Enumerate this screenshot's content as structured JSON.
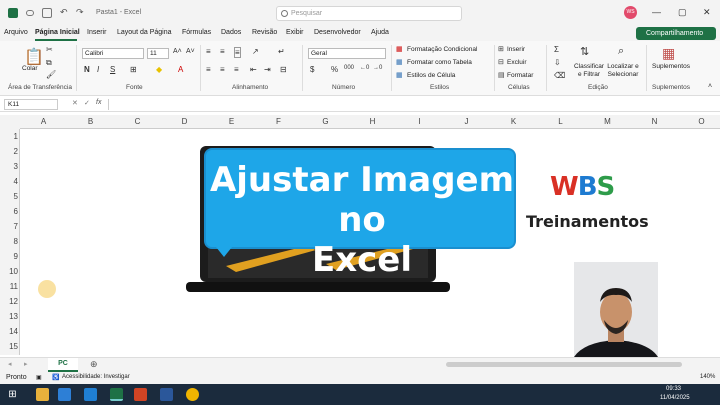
{
  "window": {
    "title": "Pasta1 - Excel",
    "search_placeholder": "Pesquisar",
    "user_initials": "WS"
  },
  "menu": {
    "items": [
      "Arquivo",
      "Página Inicial",
      "Inserir",
      "Layout da Página",
      "Fórmulas",
      "Dados",
      "Revisão",
      "Exibir",
      "Desenvolvedor",
      "Ajuda"
    ],
    "share_label": "Compartilhamento"
  },
  "ribbon": {
    "clipboard": {
      "paste_label": "Colar",
      "group_label": "Área de Transferência"
    },
    "font": {
      "font_name": "Calibri",
      "font_size": "11",
      "group_label": "Fonte"
    },
    "alignment": {
      "group_label": "Alinhamento"
    },
    "number": {
      "format": "Geral",
      "group_label": "Número"
    },
    "styles": {
      "conditional": "Formatação Condicional",
      "as_table": "Formatar como Tabela",
      "cell_styles": "Estilos de Célula",
      "group_label": "Estilos"
    },
    "cells": {
      "insert": "Inserir",
      "delete": "Excluir",
      "format": "Formatar",
      "group_label": "Células"
    },
    "editing": {
      "sort_filter": "Classificar e Filtrar",
      "find_select": "Localizar e Selecionar",
      "group_label": "Edição"
    },
    "addins": {
      "label": "Suplementos",
      "group_label": "Suplementos"
    }
  },
  "formula_bar": {
    "name_box": "K11",
    "fx": "fx"
  },
  "sheet": {
    "columns": [
      "A",
      "B",
      "C",
      "D",
      "E",
      "F",
      "G",
      "H",
      "I",
      "J",
      "K",
      "L",
      "M",
      "N",
      "O"
    ],
    "rows": [
      "1",
      "2",
      "3",
      "4",
      "5",
      "6",
      "7",
      "8",
      "9",
      "10",
      "11",
      "12",
      "13",
      "14",
      "15"
    ],
    "tabs": [
      "PC"
    ]
  },
  "image": {
    "title_line1": "Ajustar Imagem no",
    "title_line2": "Excel"
  },
  "logo": {
    "text": "WBS",
    "subtitle": "Treinamentos"
  },
  "status": {
    "ready": "Pronto",
    "accessibility": "Acessibilidade: Investigar",
    "zoom": "140%"
  },
  "taskbar": {
    "time": "09:33",
    "date": "11/04/2025"
  },
  "colors": {
    "excel_green": "#1e7145",
    "bubble_blue": "#1ea6e8"
  }
}
